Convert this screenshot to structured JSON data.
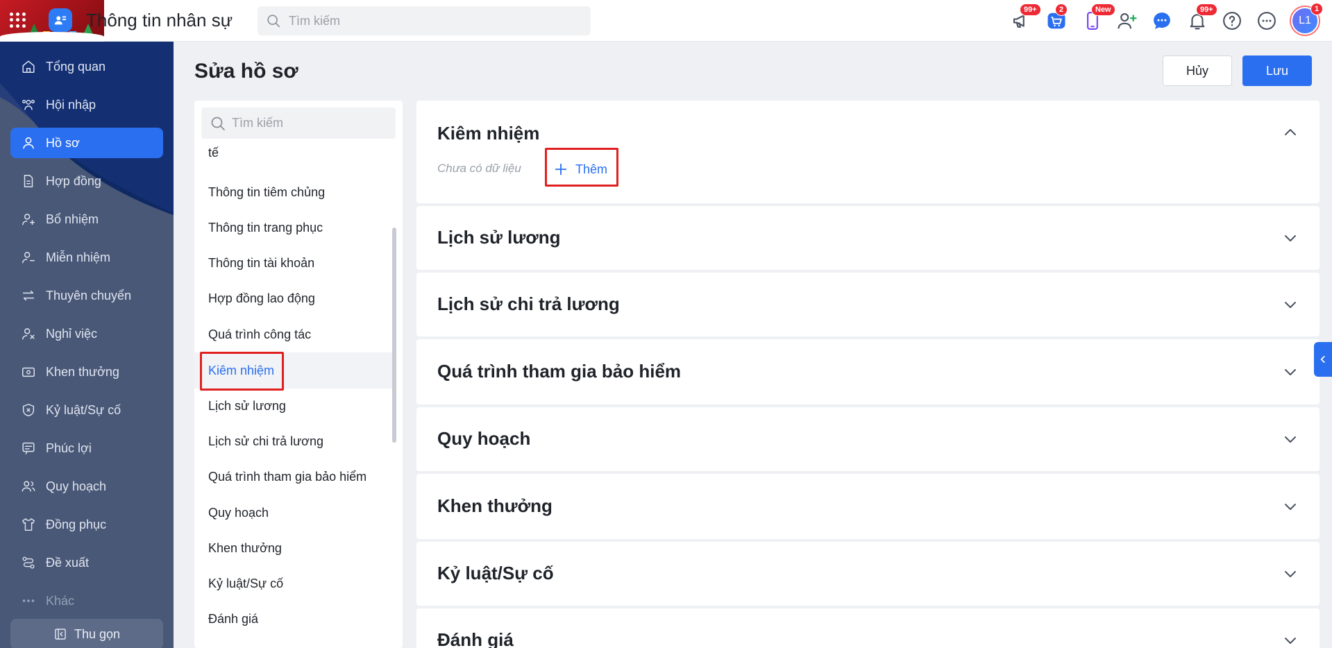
{
  "header": {
    "title": "Thông tin nhân sự",
    "search_placeholder": "Tìm kiếm",
    "badges": {
      "announcements": "99+",
      "cart": "2",
      "mobile": "New",
      "notifications": "99+",
      "avatar": "1"
    },
    "avatar_initials": "L1"
  },
  "sidebar": {
    "items": [
      {
        "label": "Tổng quan",
        "icon": "home-icon"
      },
      {
        "label": "Hội nhập",
        "icon": "group-icon"
      },
      {
        "label": "Hồ sơ",
        "icon": "user-icon"
      },
      {
        "label": "Hợp đồng",
        "icon": "document-icon"
      },
      {
        "label": "Bổ nhiệm",
        "icon": "user-plus-icon"
      },
      {
        "label": "Miễn nhiệm",
        "icon": "user-minus-icon"
      },
      {
        "label": "Thuyên chuyển",
        "icon": "transfer-icon"
      },
      {
        "label": "Nghỉ việc",
        "icon": "user-x-icon"
      },
      {
        "label": "Khen thưởng",
        "icon": "reward-icon"
      },
      {
        "label": "Kỷ luật/Sự cố",
        "icon": "shield-icon"
      },
      {
        "label": "Phúc lợi",
        "icon": "benefit-icon"
      },
      {
        "label": "Quy hoạch",
        "icon": "planning-icon"
      },
      {
        "label": "Đồng phục",
        "icon": "shirt-icon"
      },
      {
        "label": "Đề xuất",
        "icon": "proposal-icon"
      },
      {
        "label": "Khác",
        "icon": "more-icon"
      }
    ],
    "active_label": "Hồ sơ",
    "collapse_label": "Thu gọn"
  },
  "page": {
    "title": "Sửa hồ sơ",
    "cancel_label": "Hủy",
    "save_label": "Lưu"
  },
  "nav_panel": {
    "search_placeholder": "Tìm kiếm",
    "items": [
      "tế",
      "Thông tin tiêm chủng",
      "Thông tin trang phục",
      "Thông tin tài khoản",
      "Hợp đồng lao động",
      "Quá trình công tác",
      "Kiêm nhiệm",
      "Lịch sử lương",
      "Lịch sử chi trả lương",
      "Quá trình tham gia bảo hiểm",
      "Quy hoạch",
      "Khen thưởng",
      "Kỷ luật/Sự cố",
      "Đánh giá"
    ],
    "active_item": "Kiêm nhiệm"
  },
  "sections": [
    {
      "title": "Kiêm nhiệm",
      "expanded": true,
      "empty_text": "Chưa có dữ liệu",
      "add_label": "Thêm"
    },
    {
      "title": "Lịch sử lương",
      "expanded": false
    },
    {
      "title": "Lịch sử chi trả lương",
      "expanded": false
    },
    {
      "title": "Quá trình tham gia bảo hiểm",
      "expanded": false
    },
    {
      "title": "Quy hoạch",
      "expanded": false
    },
    {
      "title": "Khen thưởng",
      "expanded": false
    },
    {
      "title": "Kỷ luật/Sự cố",
      "expanded": false
    },
    {
      "title": "Đánh giá",
      "expanded": false
    }
  ],
  "colors": {
    "accent": "#2a6ff0",
    "sidebar_bg": "#4a5877",
    "highlight_box": "#e02020",
    "badge": "#ee2a35"
  }
}
